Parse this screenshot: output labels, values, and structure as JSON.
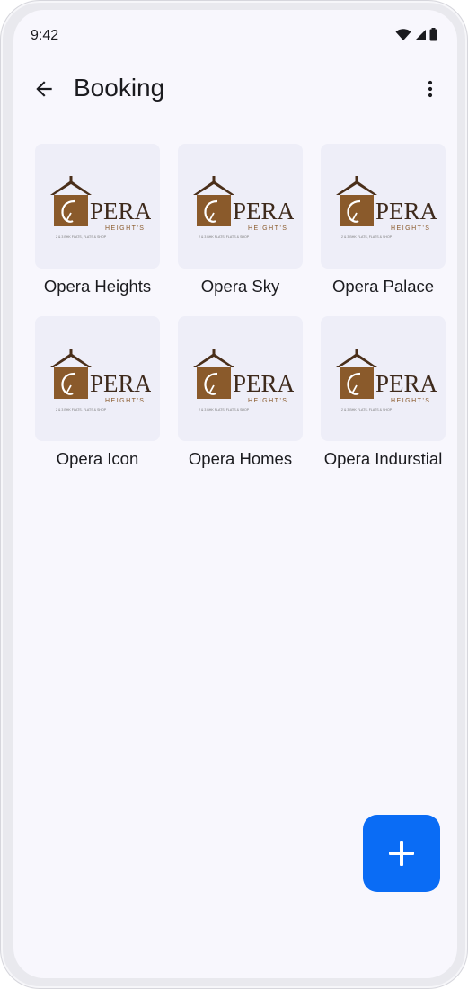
{
  "status_bar": {
    "time": "9:42"
  },
  "app_bar": {
    "title": "Booking"
  },
  "projects": [
    {
      "name": "Opera Heights"
    },
    {
      "name": "Opera Sky"
    },
    {
      "name": "Opera Palace"
    },
    {
      "name": "Opera Icon"
    },
    {
      "name": "Opera Homes"
    },
    {
      "name": "Opera Indurstial"
    }
  ],
  "logo": {
    "wordmark": "PERA",
    "subtitle": "HEIGHT'S",
    "tagline": "2 & 3 BHK FLATS, FLATS & SHOP"
  },
  "colors": {
    "accent": "#0a6cf5",
    "logo_brown": "#8a5a2b",
    "logo_roof": "#4a2f1a",
    "background": "#f8f7fd"
  },
  "icons": {
    "back": "arrow-left-icon",
    "more": "more-vert-icon",
    "fab": "plus-icon"
  }
}
